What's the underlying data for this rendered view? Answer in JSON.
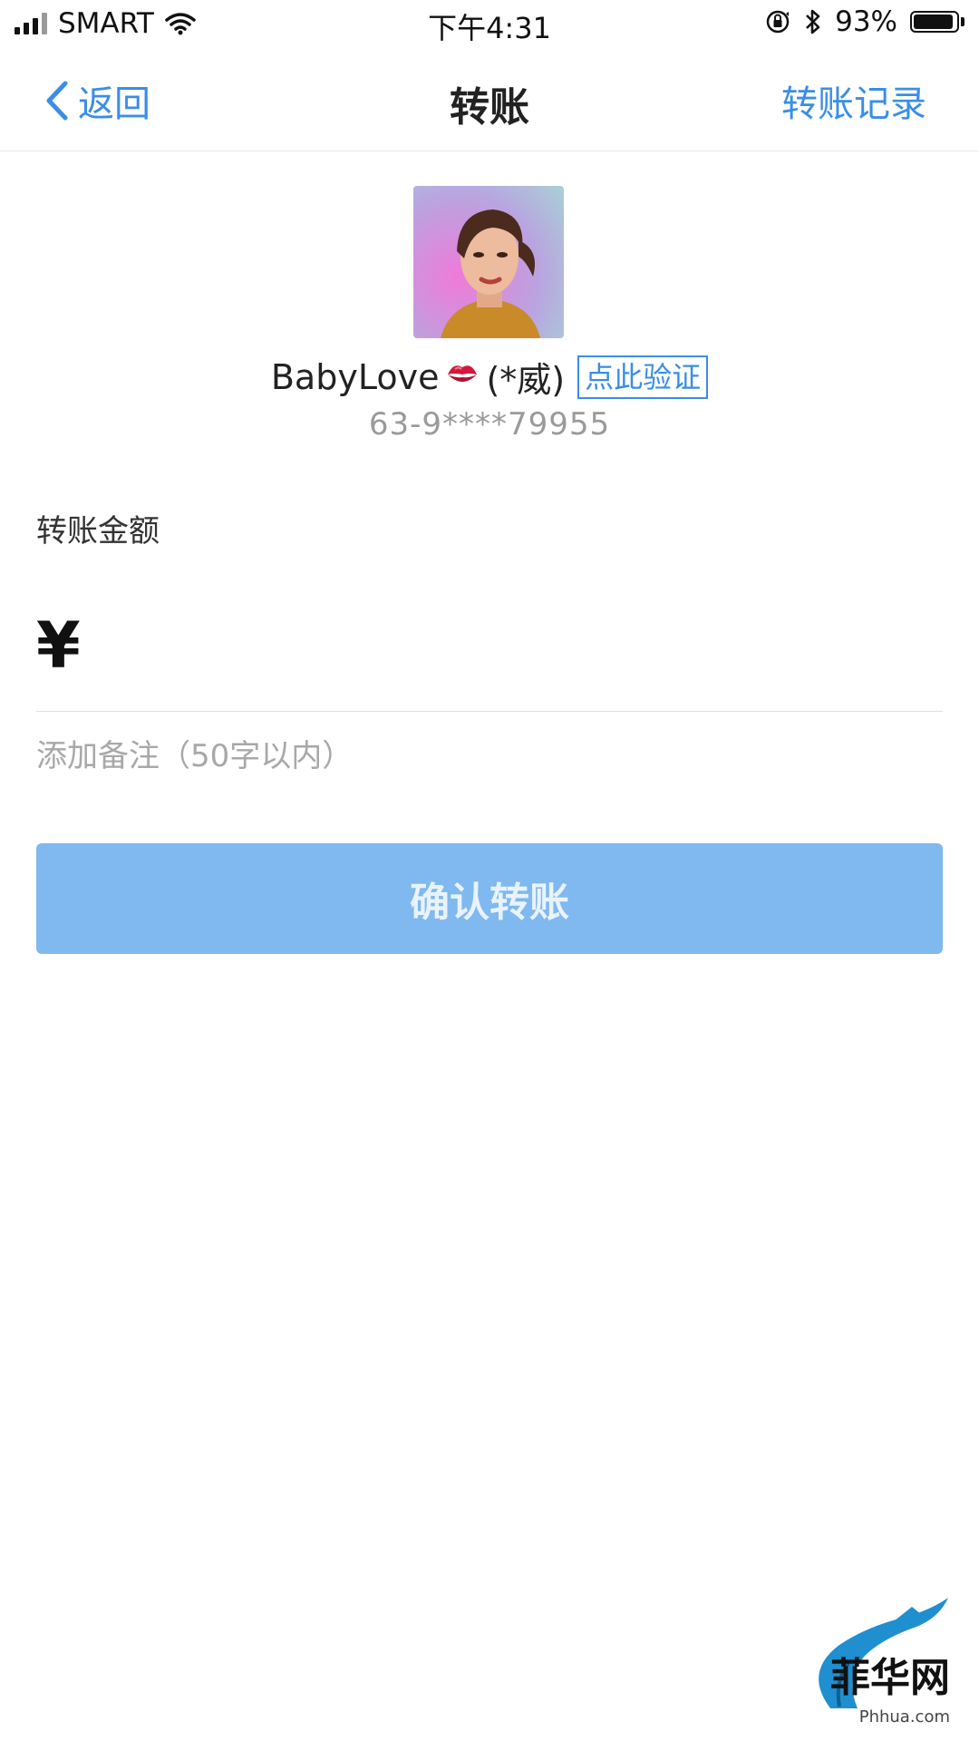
{
  "status_bar": {
    "carrier": "SMART",
    "time": "下午4:31",
    "battery_text": "93%",
    "battery_level": 0.93
  },
  "nav": {
    "back_label": "返回",
    "title": "转账",
    "right_label": "转账记录"
  },
  "recipient": {
    "name": "BabyLove",
    "emoji": "💋",
    "masked_name": "(*威)",
    "verify_label": "点此验证",
    "account": "63-9****79955"
  },
  "form": {
    "amount_label": "转账金额",
    "currency_symbol": "¥",
    "amount_value": "",
    "remark_placeholder": "添加备注（50字以内）",
    "confirm_label": "确认转账"
  },
  "watermark": {
    "text": "菲华网",
    "subtext": "Phhua.com"
  },
  "colors": {
    "accent": "#3a8ee6",
    "button_disabled": "#7fb9ef"
  }
}
